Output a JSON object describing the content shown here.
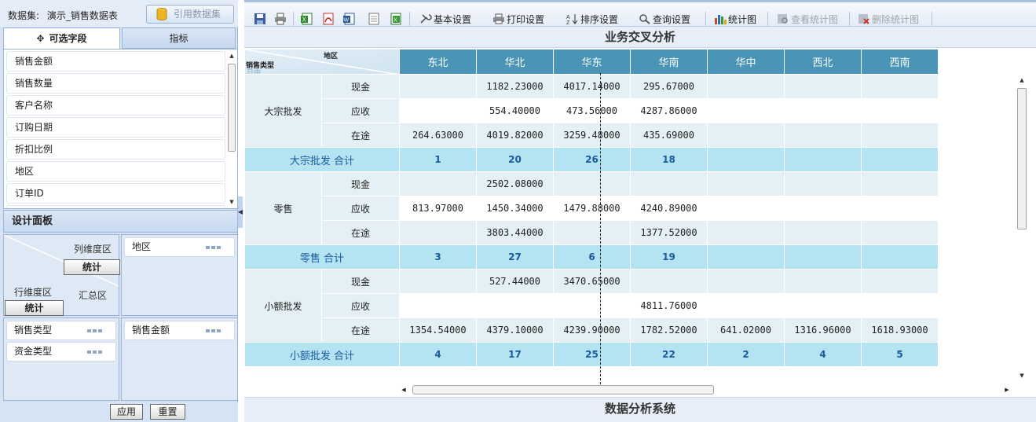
{
  "dataset": {
    "label": "数据集:",
    "name": "演示_销售数据表",
    "ref_button": "引用数据集"
  },
  "tabs": {
    "fields": "可选字段",
    "metrics": "指标"
  },
  "fields": [
    "销售金额",
    "销售数量",
    "客户名称",
    "订购日期",
    "折扣比例",
    "地区",
    "订单ID"
  ],
  "design": {
    "title": "设计面板",
    "col_dim_label": "列维度区",
    "row_dim_label": "行维度区",
    "summary_label": "汇总区",
    "stat_label": "统计",
    "col_dims": [
      "地区"
    ],
    "row_dims": [
      "销售类型",
      "资金类型"
    ],
    "values": [
      "销售金额"
    ],
    "apply": "应用",
    "reset": "重置"
  },
  "toolbar": {
    "icons": [
      "save-icon",
      "print-icon",
      "excel-export-icon",
      "pdf-export-icon",
      "word-export-icon",
      "text-export-icon",
      "csv-export-icon"
    ],
    "basic_settings": "基本设置",
    "print_settings": "打印设置",
    "sort_settings": "排序设置",
    "query_settings": "查询设置",
    "chart": "统计图",
    "view_chart": "查看统计图",
    "delete_chart": "删除统计图"
  },
  "report": {
    "title": "业务交叉分析",
    "footer": "数据分析系统",
    "corner_col": "地区",
    "corner_row": "销售类型",
    "corner_ghost": "日由",
    "columns": [
      "东北",
      "华北",
      "华东",
      "华南",
      "华中",
      "西北",
      "西南"
    ],
    "groups": [
      {
        "name": "大宗批发",
        "rows": [
          {
            "type": "现金",
            "values": [
              "",
              "1182.23000",
              "4017.14000",
              "295.67000",
              "",
              "",
              ""
            ]
          },
          {
            "type": "应收",
            "values": [
              "",
              "554.40000",
              "473.56000",
              "4287.86000",
              "",
              "",
              ""
            ]
          },
          {
            "type": "在途",
            "values": [
              "264.63000",
              "4019.82000",
              "3259.48000",
              "435.69000",
              "",
              "",
              ""
            ]
          }
        ],
        "total_label": "大宗批发 合计",
        "totals": [
          "1",
          "20",
          "26",
          "18",
          "",
          "",
          ""
        ]
      },
      {
        "name": "零售",
        "rows": [
          {
            "type": "现金",
            "values": [
              "",
              "2502.08000",
              "",
              "",
              "",
              "",
              ""
            ]
          },
          {
            "type": "应收",
            "values": [
              "813.97000",
              "1450.34000",
              "1479.88000",
              "4240.89000",
              "",
              "",
              ""
            ]
          },
          {
            "type": "在途",
            "values": [
              "",
              "3803.44000",
              "",
              "1377.52000",
              "",
              "",
              ""
            ]
          }
        ],
        "total_label": "零售 合计",
        "totals": [
          "3",
          "27",
          "6",
          "19",
          "",
          "",
          ""
        ]
      },
      {
        "name": "小额批发",
        "rows": [
          {
            "type": "现金",
            "values": [
              "",
              "527.44000",
              "3470.65000",
              "",
              "",
              "",
              ""
            ]
          },
          {
            "type": "应收",
            "values": [
              "",
              "",
              "",
              "4811.76000",
              "",
              "",
              ""
            ]
          },
          {
            "type": "在途",
            "values": [
              "1354.54000",
              "4379.10000",
              "4239.90000",
              "1782.52000",
              "641.02000",
              "1316.96000",
              "1618.93000"
            ]
          }
        ],
        "total_label": "小额批发 合计",
        "totals": [
          "4",
          "17",
          "25",
          "22",
          "2",
          "4",
          "5"
        ]
      }
    ]
  }
}
